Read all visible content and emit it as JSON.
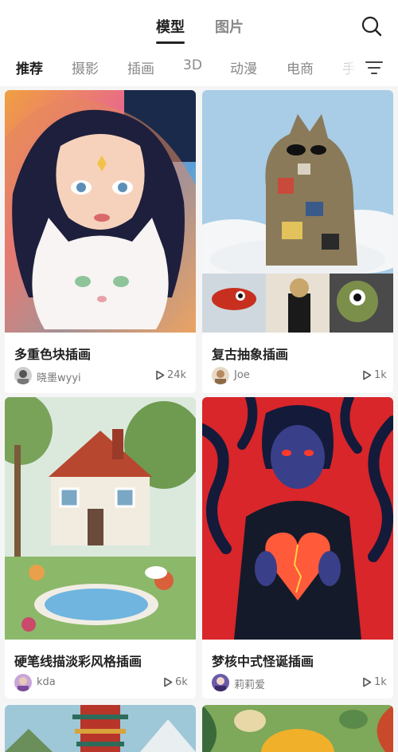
{
  "header": {
    "tabs": [
      {
        "label": "模型"
      },
      {
        "label": "图片"
      }
    ]
  },
  "categories": [
    "推荐",
    "摄影",
    "插画",
    "3D",
    "动漫",
    "电商",
    "手"
  ],
  "cards": [
    {
      "title": "多重色块插画",
      "author": "晓墨wyyi",
      "views": "24k"
    },
    {
      "title": "复古抽象插画",
      "author": "Joe",
      "views": "1k"
    },
    {
      "title": "硬笔线描淡彩风格插画",
      "author": "kda",
      "views": "6k"
    },
    {
      "title": "梦核中式怪诞插画",
      "author": "莉莉爱",
      "views": "1k"
    }
  ],
  "icons": [
    "search-icon",
    "filter-icon",
    "play-icon"
  ],
  "colors": {
    "text": "#222222",
    "muted": "#888888",
    "background": "#f5f5f5"
  }
}
